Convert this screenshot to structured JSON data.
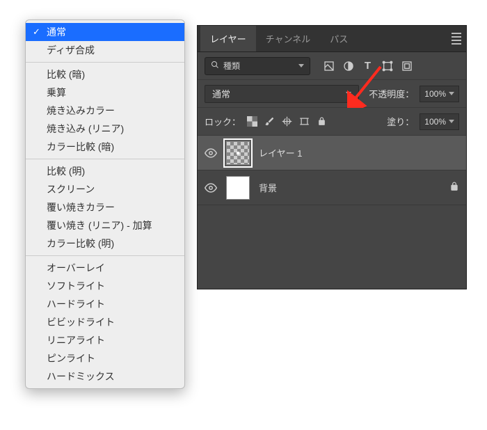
{
  "tabs": {
    "layers": "レイヤー",
    "channels": "チャンネル",
    "paths": "パス"
  },
  "filter": {
    "label": "種類"
  },
  "blend": {
    "current": "通常",
    "opacity_label": "不透明度：",
    "opacity_value": "100%"
  },
  "lock": {
    "label": "ロック：",
    "fill_label": "塗り：",
    "fill_value": "100%"
  },
  "layers": [
    {
      "name": "レイヤー 1"
    },
    {
      "name": "背景"
    }
  ],
  "menu": {
    "groups": [
      [
        {
          "label": "通常",
          "selected": true
        },
        {
          "label": "ディザ合成"
        }
      ],
      [
        {
          "label": "比較 (暗)"
        },
        {
          "label": "乗算"
        },
        {
          "label": "焼き込みカラー"
        },
        {
          "label": "焼き込み (リニア)"
        },
        {
          "label": "カラー比較 (暗)"
        }
      ],
      [
        {
          "label": "比較 (明)"
        },
        {
          "label": "スクリーン"
        },
        {
          "label": "覆い焼きカラー"
        },
        {
          "label": "覆い焼き (リニア) - 加算"
        },
        {
          "label": "カラー比較 (明)"
        }
      ],
      [
        {
          "label": "オーバーレイ"
        },
        {
          "label": "ソフトライト"
        },
        {
          "label": "ハードライト"
        },
        {
          "label": "ビビッドライト"
        },
        {
          "label": "リニアライト"
        },
        {
          "label": "ピンライト"
        },
        {
          "label": "ハードミックス"
        }
      ]
    ]
  }
}
